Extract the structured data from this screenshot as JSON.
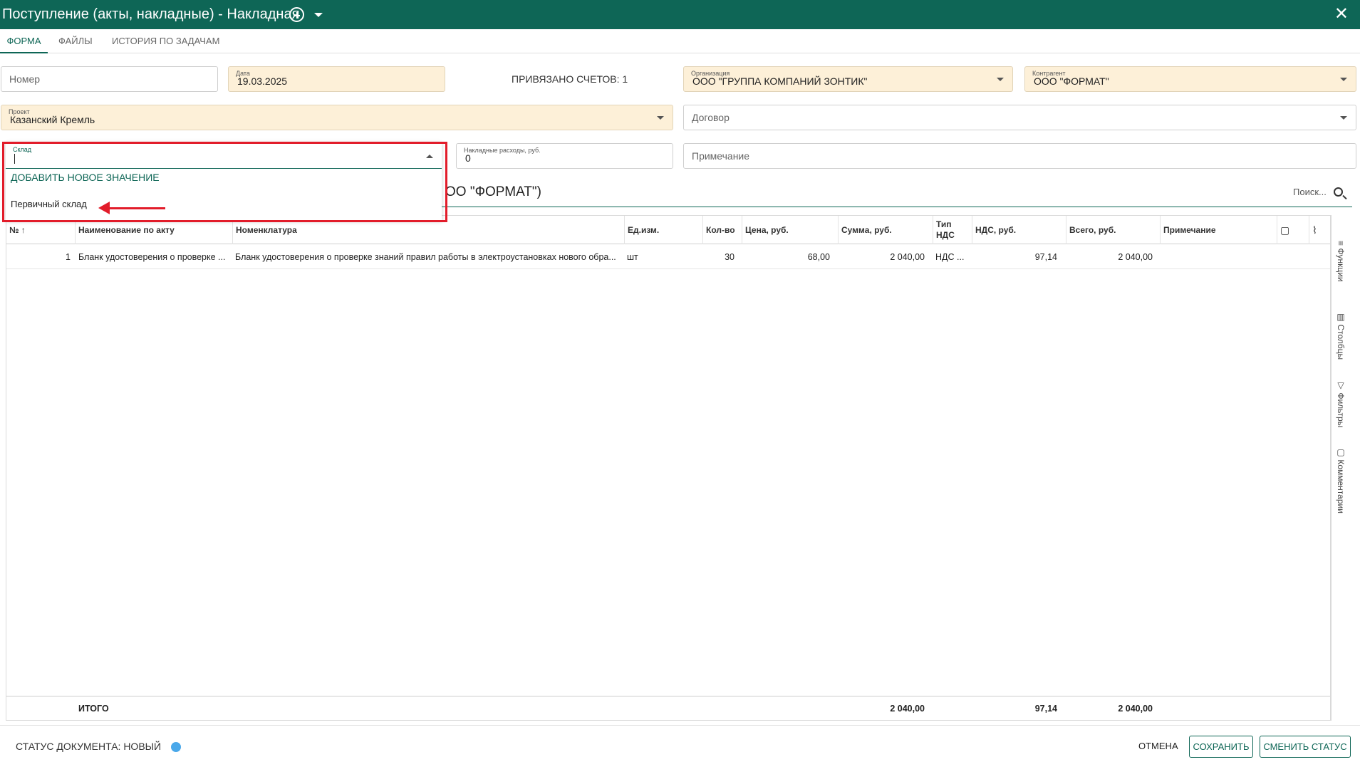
{
  "window": {
    "title": "Поступление (акты, накладные) - Накладная"
  },
  "tabs": [
    {
      "label": "ФОРМА",
      "active": true
    },
    {
      "label": "ФАЙЛЫ",
      "active": false
    },
    {
      "label": "ИСТОРИЯ ПО ЗАДАЧАМ",
      "active": false
    }
  ],
  "form": {
    "number": {
      "placeholder": "Номер"
    },
    "date": {
      "label": "Дата",
      "value": "19.03.2025"
    },
    "linked_accounts": "ПРИВЯЗАНО СЧЕТОВ: 1",
    "organization": {
      "label": "Организация",
      "value": "ООО \"ГРУППА КОМПАНИЙ ЗОНТИК\""
    },
    "contractor": {
      "label": "Контрагент",
      "value": "ООО \"ФОРМАТ\""
    },
    "project": {
      "label": "Проект",
      "value": "Казанский Кремль"
    },
    "contract": {
      "placeholder": "Договор"
    },
    "warehouse": {
      "label": "Склад",
      "value": ""
    },
    "overhead": {
      "label": "Накладные расходы, руб.",
      "value": "0"
    },
    "note": {
      "placeholder": "Примечание"
    }
  },
  "warehouse_dropdown": {
    "add_new_label": "ДОБАВИТЬ НОВОЕ ЗНАЧЕНИЕ",
    "options": [
      "Первичный склад"
    ]
  },
  "section": {
    "title_visible": "ОО \"ФОРМАТ\")",
    "search_placeholder": "Поиск..."
  },
  "table": {
    "headers": {
      "num": "№",
      "act_name": "Наименование по акту",
      "nomenclature": "Номенклатура",
      "unit": "Ед.изм.",
      "qty": "Кол-во",
      "price": "Цена, руб.",
      "sum": "Сумма, руб.",
      "vat_type": "Тип НДС",
      "vat": "НДС, руб.",
      "total": "Всего, руб.",
      "note": "Примечание"
    },
    "rows": [
      {
        "num": "1",
        "act_name": "Бланк удостоверения о проверке ...",
        "nomenclature": "Бланк удостоверения о проверке знаний правил работы в электроустановках нового обра...",
        "unit": "шт",
        "qty": "30",
        "price": "68,00",
        "sum": "2 040,00",
        "vat_type": "НДС ...",
        "vat": "97,14",
        "total": "2 040,00",
        "note": ""
      }
    ],
    "totals": {
      "label": "ИТОГО",
      "sum": "2 040,00",
      "vat": "97,14",
      "total": "2 040,00"
    }
  },
  "side_tabs": [
    "Функции",
    "Столбцы",
    "Фильтры",
    "Комментарии"
  ],
  "footer": {
    "status": "СТАТУС ДОКУМЕНТА: НОВЫЙ",
    "status_color": "#4aa8ea",
    "cancel": "ОТМЕНА",
    "save": "СОХРАНИТЬ",
    "change_status": "СМЕНИТЬ СТАТУС"
  },
  "colors": {
    "brand": "#0e6656",
    "filled_field": "#fdf0d8",
    "annotation": "#e21c2a"
  }
}
